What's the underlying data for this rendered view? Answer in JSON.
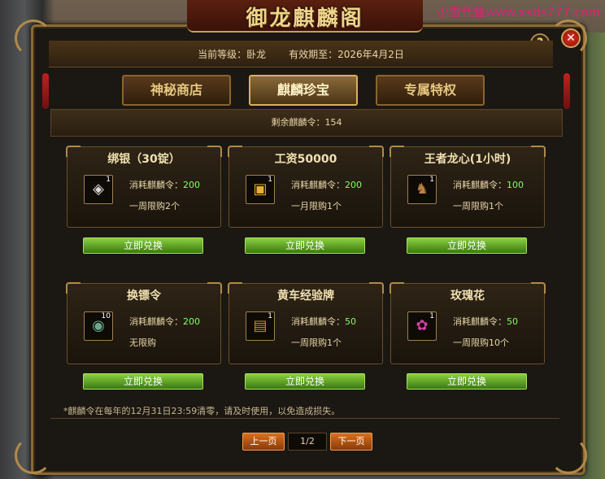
{
  "watermark": "小雪代售www.xxds777.com",
  "window": {
    "title": "御龙麒麟阁",
    "help_label": "?",
    "close_label": "✕"
  },
  "info": {
    "level": "当前等级：卧龙",
    "expiry": "有效期至：2026年4月2日"
  },
  "tabs": [
    {
      "label": "神秘商店",
      "active": false
    },
    {
      "label": "麒麟珍宝",
      "active": true
    },
    {
      "label": "专属特权",
      "active": false
    }
  ],
  "remaining": "剩余麒麟令：154",
  "items": [
    {
      "name": "绑银（30锭）",
      "cost_label": "消耗麒麟令：",
      "cost": "200",
      "limit": "一周限购2个",
      "qty": "1",
      "icon": "silver-ingot-icon",
      "glyph": "◈"
    },
    {
      "name": "工资50000",
      "cost_label": "消耗麒麟令：",
      "cost": "200",
      "limit": "一月限购1个",
      "qty": "1",
      "icon": "gold-treasure-icon",
      "glyph": "▣"
    },
    {
      "name": "王者龙心(1小时)",
      "cost_label": "消耗麒麟令：",
      "cost": "100",
      "limit": "一周限购1个",
      "qty": "1",
      "icon": "dragon-heart-icon",
      "glyph": "♞"
    },
    {
      "name": "换镖令",
      "cost_label": "消耗麒麟令：",
      "cost": "200",
      "limit": "无限购",
      "qty": "10",
      "icon": "escort-token-icon",
      "glyph": "◉"
    },
    {
      "name": "黄车经验牌",
      "cost_label": "消耗麒麟令：",
      "cost": "50",
      "limit": "一周限购1个",
      "qty": "1",
      "icon": "yellow-cart-icon",
      "glyph": "▤"
    },
    {
      "name": "玫瑰花",
      "cost_label": "消耗麒麟令：",
      "cost": "50",
      "limit": "一周限购10个",
      "qty": "1",
      "icon": "rose-icon",
      "glyph": "✿"
    }
  ],
  "redeem_label": "立即兑换",
  "note": "*麒麟令在每年的12月31日23:59清零，请及时使用，以免造成损失。",
  "pager": {
    "prev": "上一页",
    "page": "1/2",
    "next": "下一页"
  },
  "colors": {
    "cost_value": "#80ff60",
    "redeem_button": "#5aa020",
    "page_button": "#c05a14",
    "frame_gold": "#b08a4a"
  }
}
